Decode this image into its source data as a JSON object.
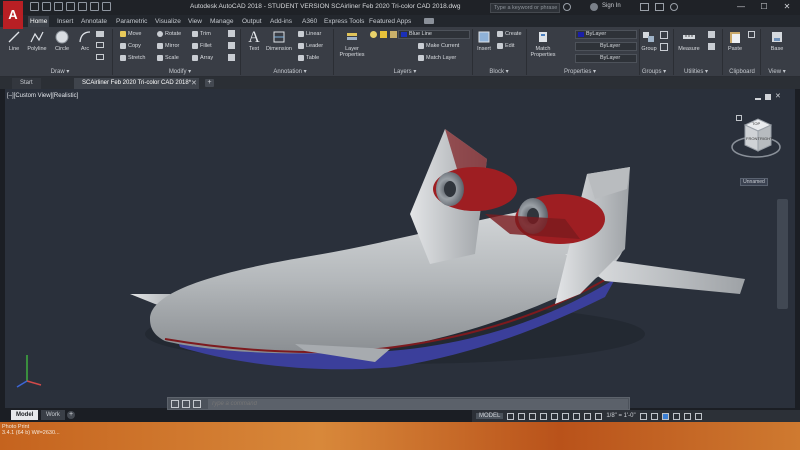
{
  "app": {
    "logo": "A",
    "window_title": "Autodesk AutoCAD 2018 - STUDENT VERSION     SCAirliner Feb 2020 Tri-color CAD 2018.dwg",
    "search_placeholder": "Type a keyword or phrase",
    "signin": "Sign In",
    "minimize": "—",
    "maximize": "☐",
    "close": "✕"
  },
  "ribbon_tabs": [
    {
      "label": "Home",
      "active": true
    },
    {
      "label": "Insert"
    },
    {
      "label": "Annotate"
    },
    {
      "label": "Parametric"
    },
    {
      "label": "Visualize"
    },
    {
      "label": "View"
    },
    {
      "label": "Manage"
    },
    {
      "label": "Output"
    },
    {
      "label": "Add-ins"
    },
    {
      "label": "A360"
    },
    {
      "label": "Express Tools"
    },
    {
      "label": "Featured Apps"
    }
  ],
  "draw": {
    "line": "Line",
    "polyline": "Polyline",
    "circle": "Circle",
    "arc": "Arc",
    "label": "Draw ▾"
  },
  "modify": {
    "move": "Move",
    "rotate": "Rotate",
    "trim": "Trim",
    "copy": "Copy",
    "mirror": "Mirror",
    "fillet": "Fillet",
    "stretch": "Stretch",
    "scale": "Scale",
    "array": "Array",
    "label": "Modify ▾"
  },
  "annotation": {
    "text": "Text",
    "dimension": "Dimension",
    "linear": "Linear",
    "leader": "Leader",
    "table": "Table",
    "label": "Annotation ▾"
  },
  "layers": {
    "layer_properties": "Layer Properties",
    "current_layer": "Blue Line",
    "make_current": "Make Current",
    "match_layer": "Match Layer",
    "label": "Layers ▾"
  },
  "block": {
    "insert": "Insert",
    "create": "Create",
    "edit": "Edit",
    "label": "Block ▾"
  },
  "properties": {
    "match_properties": "Match Properties",
    "color": "ByLayer",
    "linetype": "ByLayer",
    "lineweight": "ByLayer",
    "label": "Properties ▾"
  },
  "groups": {
    "group": "Group",
    "label": "Groups ▾"
  },
  "utilities": {
    "measure": "Measure",
    "label": "Utilities ▾"
  },
  "clipboard": {
    "paste": "Paste",
    "label": "Clipboard"
  },
  "view_panel": {
    "base": "Base",
    "label": "View ▾"
  },
  "file_tabs": [
    {
      "label": "Start"
    },
    {
      "label": "SCAirliner Feb 2020 Tri-color CAD 2018*",
      "active": true
    }
  ],
  "viewport": {
    "label": "[–][Custom View][Realistic]",
    "viewcube_face": "TOP",
    "viewcube_side": "FRONT",
    "viewcube_right": "RIGHT",
    "unnamed": "Unnamed"
  },
  "command": {
    "placeholder": "Type a command"
  },
  "layout_tabs": [
    {
      "label": "Model",
      "active": true
    },
    {
      "label": "Work"
    }
  ],
  "status": {
    "model": "MODEL",
    "scale": "1/8\" = 1'-0\"",
    "grid_icon": "grid-icon",
    "snap_icon": "snap-icon"
  },
  "left_info": {
    "line1": "Photo Print",
    "line2": "3.4.1 (64 b)    Wif=2630..."
  },
  "colors": {
    "accent_red": "#b81f24",
    "fuselage": "#b8bcbf",
    "underbelly_blue": "#3b3f9b",
    "engine_red": "#9e1e22",
    "viewport_bg": "#2a303b",
    "footer_orange": "#d8883a"
  }
}
